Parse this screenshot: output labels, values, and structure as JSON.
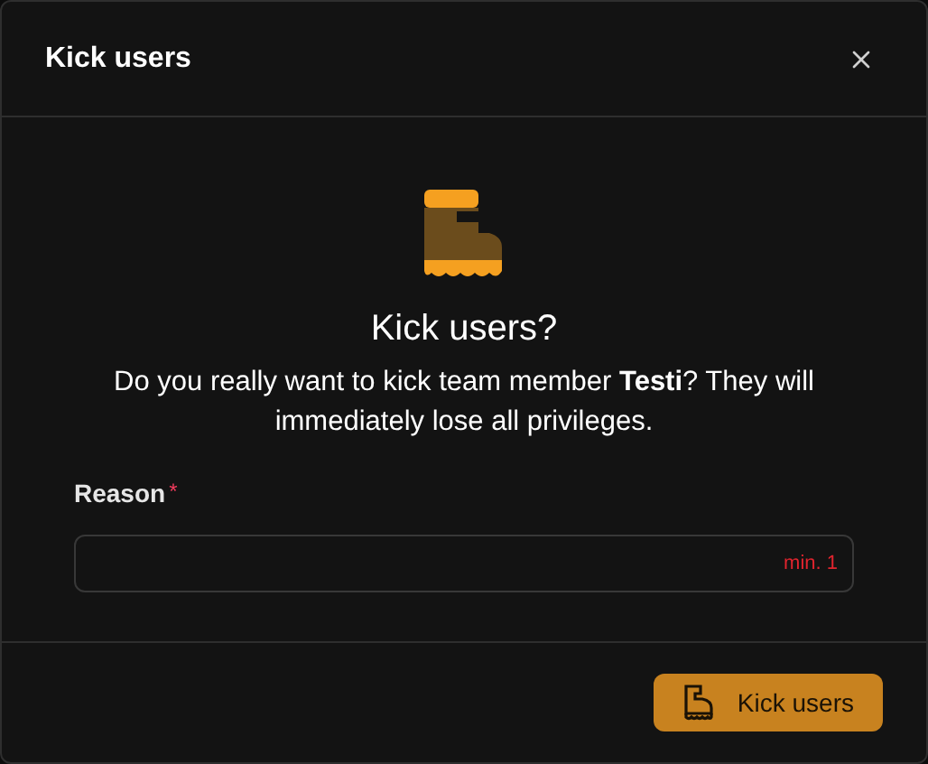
{
  "dialog": {
    "title": "Kick users",
    "heading": "Kick users?",
    "message": "Do you really want to kick team member **Testi**? They will immediately lose all privileges.",
    "field": {
      "label": "Reason",
      "required_mark": "*",
      "hint": "min. 1"
    },
    "confirm_button": "Kick users"
  }
}
